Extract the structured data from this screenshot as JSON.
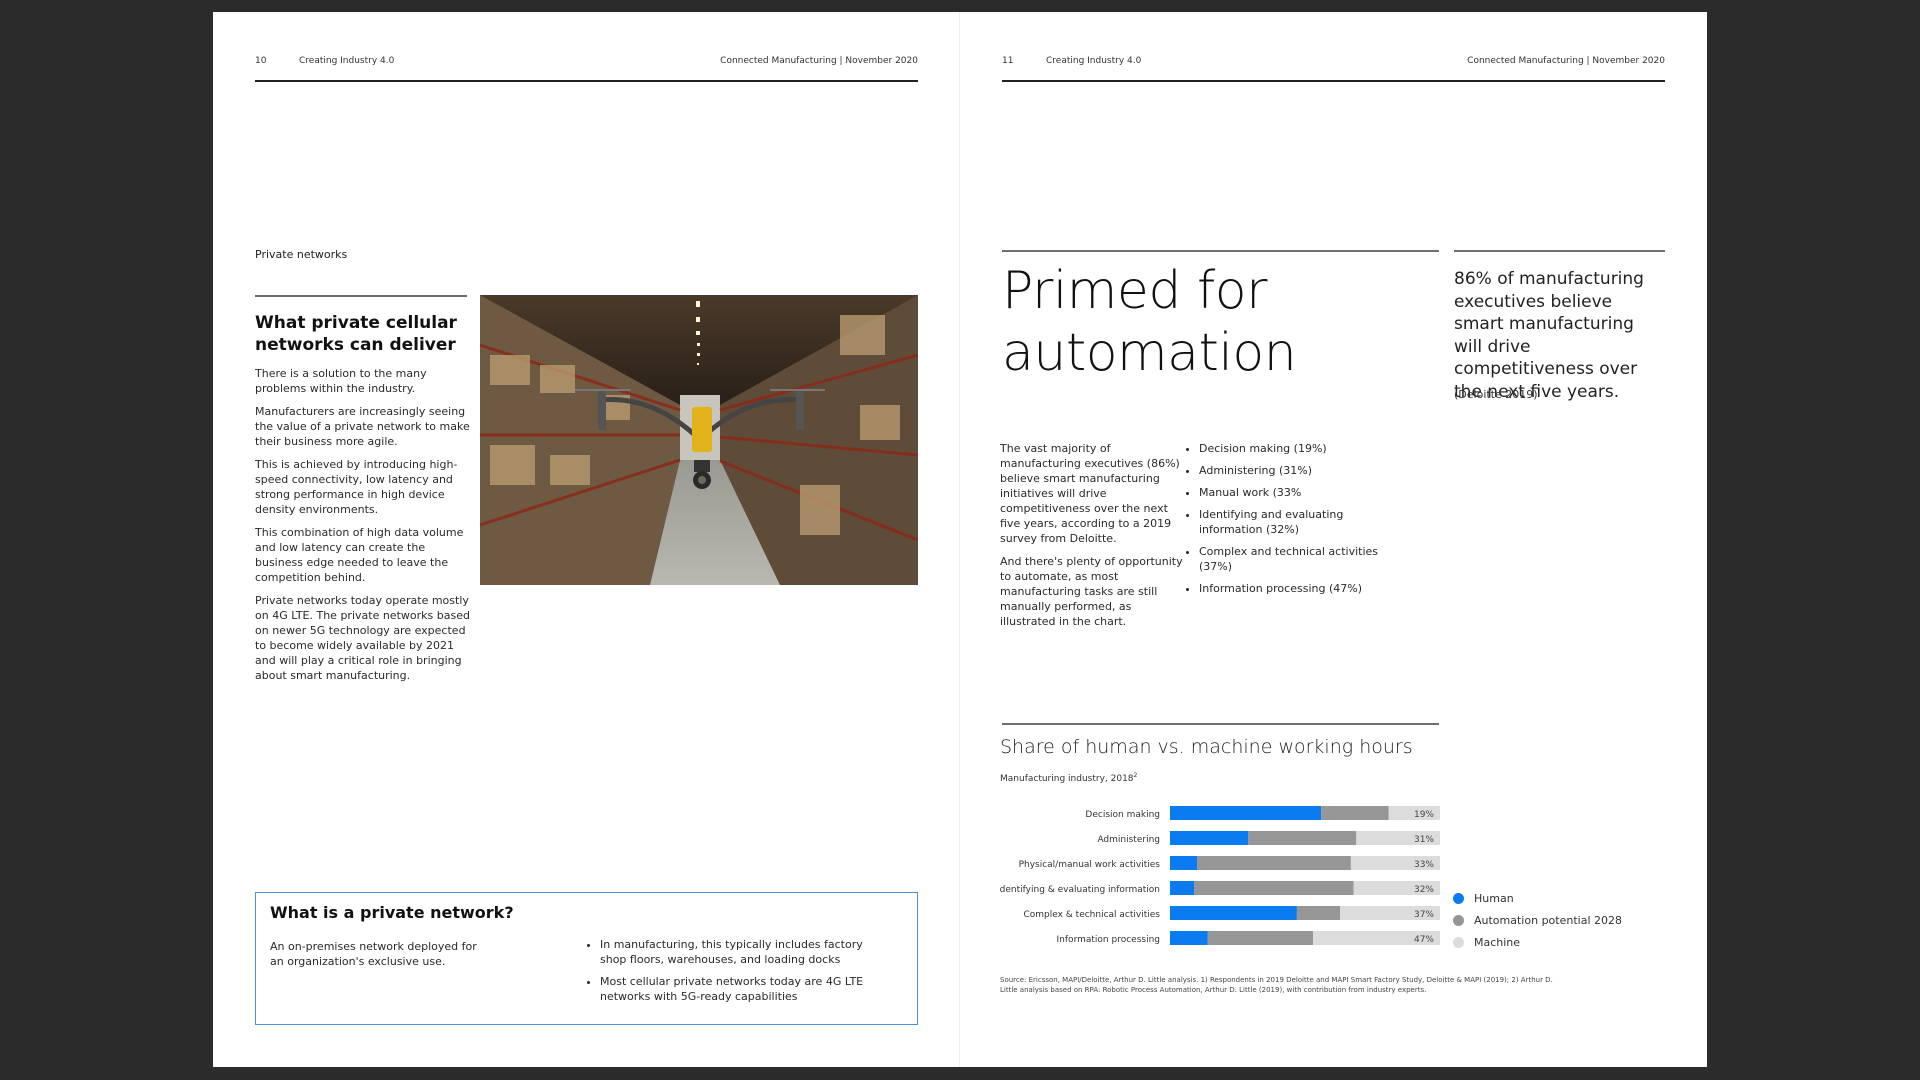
{
  "left_page": {
    "header": {
      "page_number": "10",
      "publication": "Creating Industry 4.0",
      "section_date": "Connected Manufacturing  |  November 2020"
    },
    "section_label": "Private networks",
    "heading": "What private cellular networks can deliver",
    "paragraphs": [
      "There is a solution to the many problems within the industry.",
      "Manufacturers are increasingly seeing the value of a private network to make their business more agile.",
      "This is achieved by introducing high-speed connectivity, low latency and strong performance in high device density environments.",
      "This combination of high data volume and low latency can create the business edge needed to leave the competition behind.",
      "Private networks today operate mostly on 4G LTE. The private networks based on newer 5G technology are expected to become widely available by 2021 and will play a critical role in bringing about smart manufacturing."
    ],
    "photo": {
      "alt": "Yellow drone flying down a warehouse aisle between tall shelves of boxes"
    },
    "info_box": {
      "title": "What is a private network?",
      "definition": "An on-premises network deployed for an organization's exclusive use.",
      "bullets": [
        "In manufacturing, this typically includes factory shop  floors, warehouses, and loading docks",
        "Most cellular private networks today are 4G LTE networks with 5G-ready capabilities"
      ]
    }
  },
  "right_page": {
    "header": {
      "page_number": "11",
      "publication": "Creating Industry 4.0",
      "section_date": "Connected Manufacturing  |  November 2020"
    },
    "title": "Primed for automation",
    "pull_quote": "86% of manufacturing executives believe smart manufacturing will drive competitiveness over the next five years.",
    "pull_quote_source": "(Deloitte 2019)",
    "intro_paragraphs": [
      "The vast majority of manufacturing executives (86%) believe smart manufacturing initiatives will drive competitiveness over the next five years, according to a 2019 survey from Deloitte.",
      "And there's plenty of opportunity to automate, as most manufacturing tasks are still manually performed, as illustrated in the chart."
    ],
    "task_bullets": [
      "Decision making (19%)",
      "Administering (31%)",
      "Manual work (33%",
      "Identifying and evaluating information (32%)",
      "Complex and technical activities (37%)",
      "Information processing (47%)"
    ],
    "footnote": "Source: Ericsson, MAPI/Deloitte, Arthur D. Little analysis. 1) Respondents in 2019 Deloitte and MAPI Smart Factory Study, Deloitte & MAPI (2019); 2) Arthur D. Little analysis based on RPA: Robotic Process Automation, Arthur D.  Little (2019), with contribution from industry experts."
  },
  "chart_data": {
    "type": "bar",
    "orientation": "horizontal-stacked-100",
    "title": "Share of human vs. machine working hours",
    "subtitle": "Manufacturing industry, 2018",
    "subtitle_footnote_mark": "2",
    "categories": [
      "Decision making",
      "Administering",
      "Physical/manual work activities",
      "Identifying & evaluating information",
      "Complex & technical activities",
      "Information processing"
    ],
    "series": [
      {
        "name": "Human",
        "color": "#0a7cf0",
        "values": [
          56,
          29,
          10,
          9,
          47,
          14
        ]
      },
      {
        "name": "Automation potential 2028",
        "color": "#969696",
        "values": [
          25,
          40,
          57,
          59,
          16,
          39
        ]
      },
      {
        "name": "Machine",
        "color": "#dcdcdc",
        "values": [
          19,
          31,
          33,
          32,
          37,
          47
        ]
      }
    ],
    "data_labels": [
      "19%",
      "31%",
      "33%",
      "32%",
      "37%",
      "47%"
    ],
    "xlim": [
      0,
      100
    ],
    "xlabel": "",
    "ylabel": "",
    "grid": false,
    "legend": "right"
  }
}
